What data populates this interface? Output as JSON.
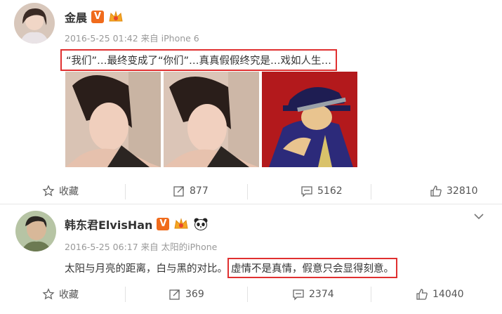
{
  "posts": [
    {
      "author": "金晨",
      "meta": "2016-5-25 01:42 来自 iPhone 6",
      "text": "“我们”…最终变成了“你们”…真真假假终究是…戏如人生…",
      "actions": {
        "favorite": "收藏",
        "repost": "877",
        "comment": "5162",
        "like": "32810"
      }
    },
    {
      "author": "韩东君ElvisHan",
      "meta": "2016-5-25 06:17 来自 太阳的iPhone",
      "text_plain": "太阳与月亮的距离，白与黑的对比。",
      "text_highlight": "虚情不是真情，假意只会显得刻意。",
      "actions": {
        "favorite": "收藏",
        "repost": "369",
        "comment": "2374",
        "like": "14040"
      }
    }
  ],
  "colors": {
    "highlight_box": "#e03030",
    "verified_badge": "#f06b1c",
    "meta_text": "#999999"
  },
  "icons": [
    "star-icon",
    "repost-icon",
    "comment-icon",
    "like-icon",
    "chevron-down-icon",
    "crown-icon",
    "panda-icon"
  ]
}
